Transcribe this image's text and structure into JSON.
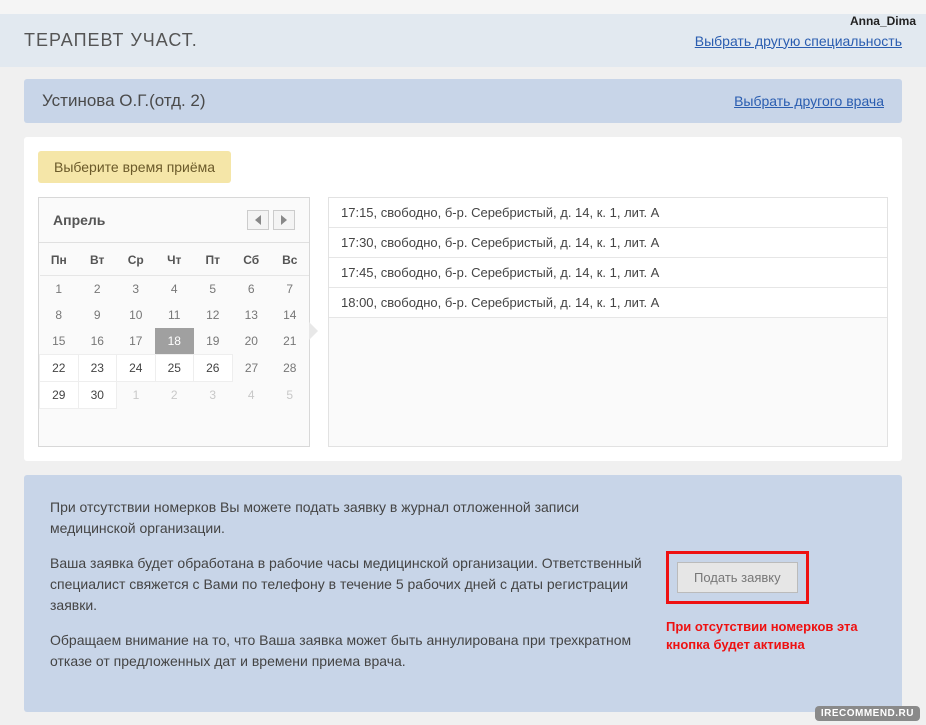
{
  "watermark_top": "Anna_Dima",
  "watermark_bottom": "IRECOMMEND.RU",
  "speciality": {
    "title": "ТЕРАПЕВТ УЧАСТ.",
    "change_link": "Выбрать другую специальность"
  },
  "doctor": {
    "name": "Устинова О.Г.(отд. 2)",
    "change_link": "Выбрать другого врача"
  },
  "choose_time_label": "Выберите время приёма",
  "calendar": {
    "month": "Апрель",
    "weekdays": [
      "Пн",
      "Вт",
      "Ср",
      "Чт",
      "Пт",
      "Сб",
      "Вс"
    ],
    "rows": [
      [
        {
          "d": "1"
        },
        {
          "d": "2"
        },
        {
          "d": "3"
        },
        {
          "d": "4"
        },
        {
          "d": "5"
        },
        {
          "d": "6"
        },
        {
          "d": "7"
        }
      ],
      [
        {
          "d": "8"
        },
        {
          "d": "9"
        },
        {
          "d": "10"
        },
        {
          "d": "11"
        },
        {
          "d": "12"
        },
        {
          "d": "13"
        },
        {
          "d": "14"
        }
      ],
      [
        {
          "d": "15"
        },
        {
          "d": "16"
        },
        {
          "d": "17"
        },
        {
          "d": "18",
          "selected": true
        },
        {
          "d": "19"
        },
        {
          "d": "20"
        },
        {
          "d": "21"
        }
      ],
      [
        {
          "d": "22",
          "avail": true
        },
        {
          "d": "23",
          "avail": true
        },
        {
          "d": "24",
          "avail": true
        },
        {
          "d": "25",
          "avail": true
        },
        {
          "d": "26",
          "avail": true
        },
        {
          "d": "27"
        },
        {
          "d": "28"
        }
      ],
      [
        {
          "d": "29",
          "avail": true
        },
        {
          "d": "30",
          "avail": true
        },
        {
          "d": "1",
          "muted": true
        },
        {
          "d": "2",
          "muted": true
        },
        {
          "d": "3",
          "muted": true
        },
        {
          "d": "4",
          "muted": true
        },
        {
          "d": "5",
          "muted": true
        }
      ]
    ]
  },
  "slots": [
    "17:15, свободно, б-р. Серебристый, д. 14, к. 1, лит. А",
    "17:30, свободно, б-р. Серебристый, д. 14, к. 1, лит. А",
    "17:45, свободно, б-р. Серебристый, д. 14, к. 1, лит. А",
    "18:00, свободно, б-р. Серебристый, д. 14, к. 1, лит. А"
  ],
  "footer": {
    "p1": "При отсутствии номерков Вы можете подать заявку в журнал отложенной записи медицинской организации.",
    "p2": "Ваша заявка будет обработана в рабочие часы медицинской организации. Ответственный специалист свяжется с Вами по телефону в течение 5 рабочих дней с даты регистрации заявки.",
    "p3": "Обращаем внимание на то, что Ваша заявка может быть аннулирована при трехкратном отказе от предложенных дат и времени приема врача.",
    "submit_label": "Подать заявку",
    "red_note": "При отсутствии номерков эта кнопка будет активна"
  }
}
